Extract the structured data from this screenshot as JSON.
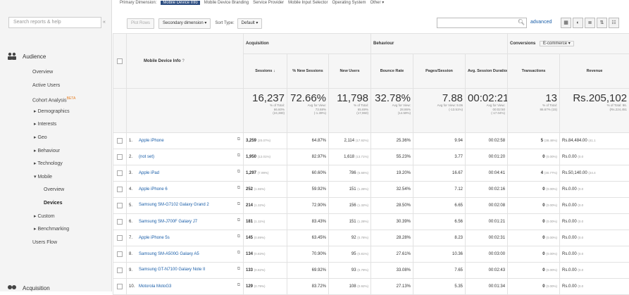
{
  "sidebar": {
    "search_placeholder": "Search reports & help",
    "collapse": "«",
    "section": "Audience",
    "items": [
      {
        "label": "Overview",
        "indent": 46
      },
      {
        "label": "Active Users",
        "indent": 46
      },
      {
        "label": "Cohort Analysis",
        "indent": 46,
        "beta": "BETA"
      },
      {
        "label": "▸ Demographics",
        "indent": 48
      },
      {
        "label": "▸ Interests",
        "indent": 48
      },
      {
        "label": "▸ Geo",
        "indent": 48
      },
      {
        "label": "▸ Behaviour",
        "indent": 48
      },
      {
        "label": "▸ Technology",
        "indent": 48
      },
      {
        "label": "▾ Mobile",
        "indent": 48
      },
      {
        "label": "Overview",
        "indent": 62
      },
      {
        "label": "Devices",
        "indent": 62,
        "active": true
      },
      {
        "label": "▸ Custom",
        "indent": 48
      },
      {
        "label": "▸ Benchmarking",
        "indent": 48
      },
      {
        "label": "Users Flow",
        "indent": 46
      }
    ],
    "bottom": "Acquisition"
  },
  "topnav": {
    "items": [
      "Primary Dimension:",
      "Mobile Device Info",
      "Mobile Device Branding",
      "Service Provider",
      "Mobile Input Selector",
      "Operating System",
      "Other ▾"
    ],
    "active_index": 1
  },
  "toolbar": {
    "plot_rows": "Plot Rows",
    "secondary": "Secondary dimension ▾",
    "sort_type_label": "Sort Type:",
    "sort_type_value": "Default ▾",
    "advanced": "advanced",
    "views": [
      "▦",
      "◐",
      "≣",
      "⇅",
      "☷"
    ]
  },
  "table": {
    "header_dim": "Mobile Device Info",
    "groups": {
      "acquisition": "Acquisition",
      "behaviour": "Behaviour",
      "conversions": "Conversions",
      "conv_select": "E-commerce ▾"
    },
    "columns": [
      "Sessions ↓",
      "% New Sessions",
      "New Users",
      "Bounce Rate",
      "Pages/Session",
      "Avg. Session Duration",
      "Transactions",
      "Revenue"
    ],
    "totals": [
      {
        "big": "16,237",
        "small": [
          "% of Total:",
          "66.60%",
          "(24,380)"
        ]
      },
      {
        "big": "72.66%",
        "small": [
          "Avg for View:",
          "73.68%",
          "(-1.39%)"
        ]
      },
      {
        "big": "11,798",
        "small": [
          "% of Total:",
          "65.69%",
          "(17,960)"
        ]
      },
      {
        "big": "32.78%",
        "small": [
          "Avg for View:",
          "28.86%",
          "(14.59%)"
        ]
      },
      {
        "big": "7.88",
        "small": [
          "Avg for View: 9.06",
          "(-13.51%)"
        ]
      },
      {
        "big": "00:02:21",
        "small": [
          "Avg for View:",
          "00:02:50",
          "(-17.04%)"
        ]
      },
      {
        "big": "13",
        "small": [
          "% of Total:",
          "86.67% (15)"
        ]
      },
      {
        "big": "Rs.205,102",
        "small": [
          "% of Total: 96.",
          "(Rs.224,451"
        ]
      }
    ],
    "rows": [
      {
        "n": "1.",
        "device": "Apple iPhone",
        "sessions": "3,259",
        "sp": "(20.07%)",
        "newpct": "64.87%",
        "newusers": "2,114",
        "np": "(17.92%)",
        "bounce": "25.36%",
        "pages": "9.94",
        "dur": "00:02:58",
        "trans": "5",
        "tp": "(38.46%)",
        "rev": "Rs.84,484.00",
        "rp": "(41.1"
      },
      {
        "n": "2.",
        "device": "(not set)",
        "sessions": "1,950",
        "sp": "(12.01%)",
        "newpct": "82.97%",
        "newusers": "1,618",
        "np": "(13.71%)",
        "bounce": "55.23%",
        "pages": "3.77",
        "dur": "00:01:20",
        "trans": "0",
        "tp": "(0.00%)",
        "rev": "Rs.0.00",
        "rp": "(0.0"
      },
      {
        "n": "3.",
        "device": "Apple iPad",
        "sessions": "1,297",
        "sp": "(7.99%)",
        "newpct": "60.60%",
        "newusers": "786",
        "np": "(6.66%)",
        "bounce": "19.20%",
        "pages": "16.67",
        "dur": "00:04:41",
        "trans": "4",
        "tp": "(30.77%)",
        "rev": "Rs.50,140.00",
        "rp": "(24.4"
      },
      {
        "n": "4.",
        "device": "Apple iPhone 6",
        "sessions": "252",
        "sp": "(1.55%)",
        "newpct": "59.92%",
        "newusers": "151",
        "np": "(1.28%)",
        "bounce": "32.54%",
        "pages": "7.12",
        "dur": "00:02:16",
        "trans": "0",
        "tp": "(0.00%)",
        "rev": "Rs.0.00",
        "rp": "(0.0"
      },
      {
        "n": "5.",
        "device": "Samsung SM-G7102 Galaxy Grand 2",
        "sessions": "214",
        "sp": "(1.32%)",
        "newpct": "72.90%",
        "newusers": "156",
        "np": "(1.32%)",
        "bounce": "28.50%",
        "pages": "6.65",
        "dur": "00:02:08",
        "trans": "0",
        "tp": "(0.00%)",
        "rev": "Rs.0.00",
        "rp": "(0.0"
      },
      {
        "n": "6.",
        "device": "Samsung SM-J700F Galaxy J7",
        "sessions": "181",
        "sp": "(1.11%)",
        "newpct": "83.43%",
        "newusers": "151",
        "np": "(1.28%)",
        "bounce": "30.39%",
        "pages": "6.56",
        "dur": "00:01:21",
        "trans": "0",
        "tp": "(0.00%)",
        "rev": "Rs.0.00",
        "rp": "(0.0"
      },
      {
        "n": "7.",
        "device": "Apple iPhone 5s",
        "sessions": "145",
        "sp": "(0.89%)",
        "newpct": "63.45%",
        "newusers": "92",
        "np": "(0.78%)",
        "bounce": "28.28%",
        "pages": "8.23",
        "dur": "00:02:31",
        "trans": "0",
        "tp": "(0.00%)",
        "rev": "Rs.0.00",
        "rp": "(0.0"
      },
      {
        "n": "8.",
        "device": "Samsung SM-A500G Galaxy A5",
        "sessions": "134",
        "sp": "(0.83%)",
        "newpct": "70.90%",
        "newusers": "95",
        "np": "(0.81%)",
        "bounce": "27.61%",
        "pages": "10.36",
        "dur": "00:03:00",
        "trans": "0",
        "tp": "(0.00%)",
        "rev": "Rs.0.00",
        "rp": "(0.0"
      },
      {
        "n": "9.",
        "device": "Samsung GT-N7100 Galaxy Note II",
        "sessions": "133",
        "sp": "(0.82%)",
        "newpct": "69.92%",
        "newusers": "93",
        "np": "(0.79%)",
        "bounce": "33.08%",
        "pages": "7.65",
        "dur": "00:02:43",
        "trans": "0",
        "tp": "(0.00%)",
        "rev": "Rs.0.00",
        "rp": "(0.0"
      },
      {
        "n": "10.",
        "device": "Motorola MotoG3",
        "sessions": "129",
        "sp": "(0.79%)",
        "newpct": "83.72%",
        "newusers": "108",
        "np": "(0.92%)",
        "bounce": "27.13%",
        "pages": "5.35",
        "dur": "00:01:34",
        "trans": "0",
        "tp": "(0.00%)",
        "rev": "Rs.0.00",
        "rp": "(0.0"
      }
    ]
  }
}
